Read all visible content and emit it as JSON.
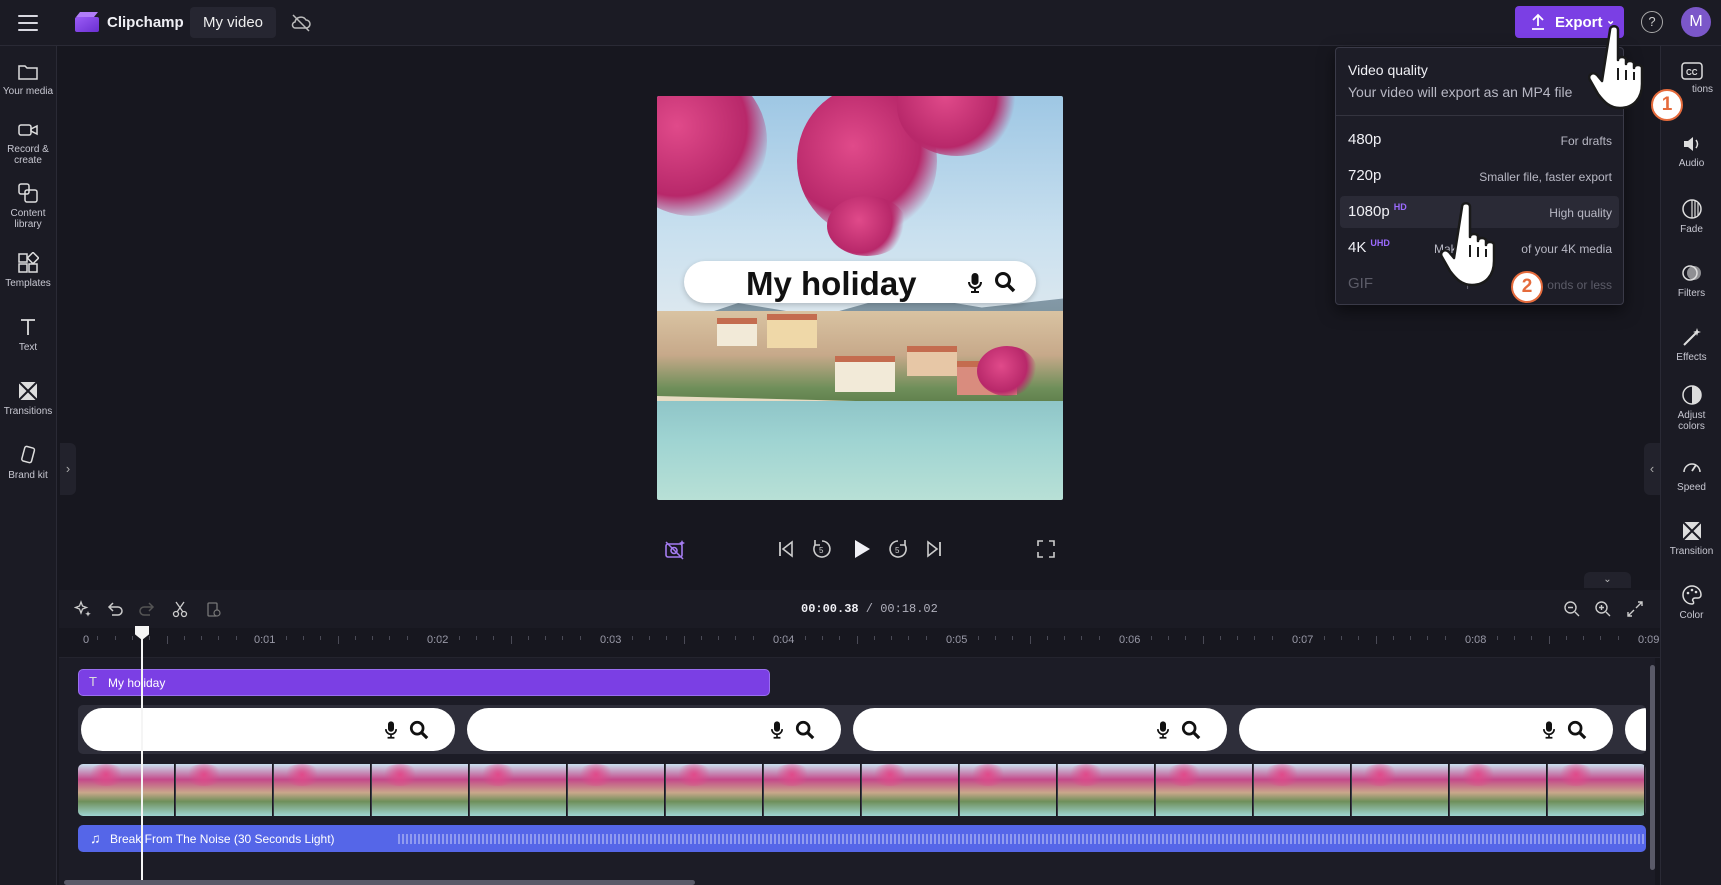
{
  "app": {
    "name": "Clipchamp",
    "project_title": "My video"
  },
  "topbar": {
    "export_label": "Export",
    "help_label": "?",
    "avatar_initial": "M"
  },
  "left_sidebar": {
    "items": [
      {
        "label": "Your media"
      },
      {
        "label": "Record & create"
      },
      {
        "label": "Content library"
      },
      {
        "label": "Templates"
      },
      {
        "label": "Text"
      },
      {
        "label": "Transitions"
      },
      {
        "label": "Brand kit"
      }
    ]
  },
  "right_sidebar": {
    "items": [
      {
        "label": "Captions",
        "visible_label": "tions"
      },
      {
        "label": "Audio"
      },
      {
        "label": "Fade"
      },
      {
        "label": "Filters"
      },
      {
        "label": "Effects"
      },
      {
        "label": "Adjust colors"
      },
      {
        "label": "Speed"
      },
      {
        "label": "Transition"
      },
      {
        "label": "Color"
      }
    ]
  },
  "preview": {
    "overlay_text": "My holiday"
  },
  "export_menu": {
    "title": "Video quality",
    "subtitle": "Your video will export as an MP4 file",
    "options": [
      {
        "quality": "480p",
        "badge": "",
        "desc": "For drafts"
      },
      {
        "quality": "720p",
        "badge": "",
        "desc": "Smaller file, faster export"
      },
      {
        "quality": "1080p",
        "badge": "HD",
        "desc": "High quality"
      },
      {
        "quality": "4K",
        "badge": "UHD",
        "desc": "Make the most of your 4K media",
        "visible_desc_left": "Make",
        "visible_desc_right": "of your 4K media"
      },
      {
        "quality": "GIF",
        "badge": "",
        "desc": "For videos 15 seconds or less",
        "visible_desc_left": "F",
        "visible_desc_right": "onds or less"
      }
    ]
  },
  "timeline": {
    "current_time": "00:00.38",
    "separator": " / ",
    "total_time": "00:18.02",
    "ruler_labels": [
      "0",
      "0:01",
      "0:02",
      "0:03",
      "0:04",
      "0:05",
      "0:06",
      "0:07",
      "0:08",
      "0:09"
    ],
    "text_clip_label": "My holiday",
    "audio_clip_label": "Break From The Noise (30 Seconds Light)"
  },
  "annotations": {
    "step1": "1",
    "step2": "2"
  },
  "colors": {
    "accent": "#7b3fe4",
    "badge": "#9c6bff",
    "audio": "#5566e8",
    "step_badge": "#e56b3c"
  },
  "icons": [
    "menu-icon",
    "clipchamp-logo-icon",
    "cloud-off-icon",
    "upload-icon",
    "help-icon",
    "folder-icon",
    "camera-icon",
    "library-icon",
    "templates-icon",
    "text-icon",
    "transitions-icon",
    "brand-kit-icon",
    "captions-icon",
    "audio-icon",
    "fade-icon",
    "filters-icon",
    "effects-icon",
    "adjust-colors-icon",
    "speed-icon",
    "color-icon",
    "mic-icon",
    "search-icon"
  ]
}
